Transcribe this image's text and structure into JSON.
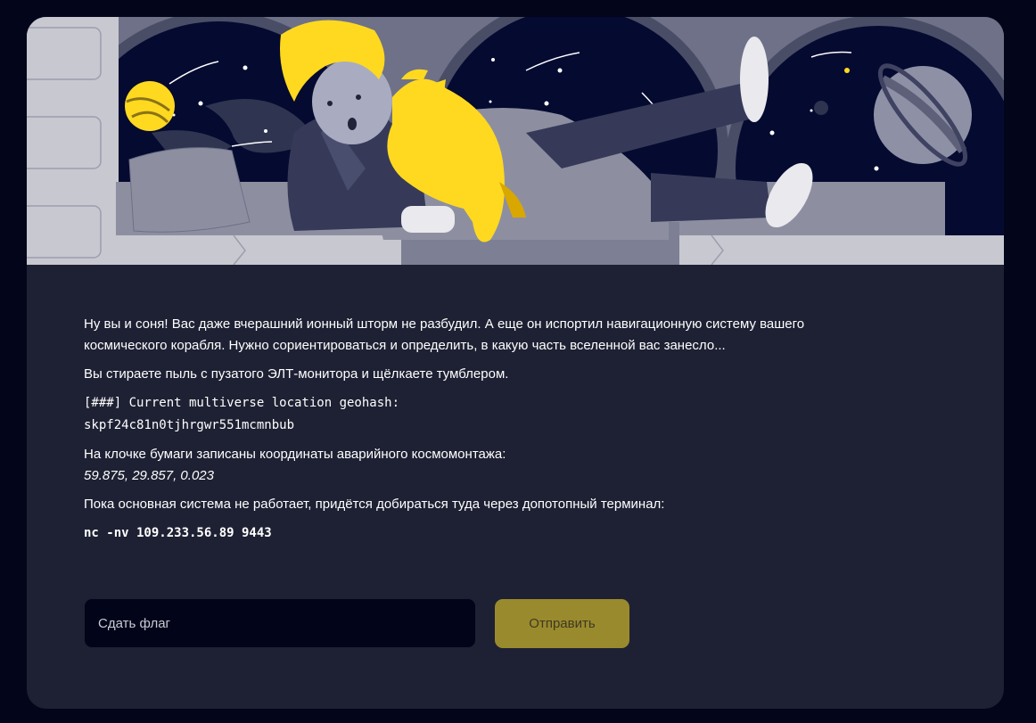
{
  "task": {
    "paragraph_1": "Ну вы и соня! Вас даже вчерашний ионный шторм не разбудил. А еще он испортил навигационную систему вашего космического корабля. Нужно сориентироваться и определить, в какую часть вселенной вас занесло...",
    "paragraph_2": "Вы стираете пыль с пузатого ЭЛТ-монитора и щёлкаете тумблером.",
    "terminal_line": "[###] Current multiverse location geohash:",
    "geohash": "skpf24c81n0tjhrgwr551mcmnbub",
    "paragraph_3": "На клочке бумаги записаны координаты аварийного космомонтажа:",
    "coordinates": "59.875, 29.857, 0.023",
    "paragraph_4": "Пока основная система не работает, придётся добираться туда через допотопный терминал:",
    "command": "nc -nv 109.233.56.89 9443"
  },
  "form": {
    "flag_placeholder": "Сдать флаг",
    "flag_value": "",
    "submit_label": "Отправить"
  },
  "colors": {
    "page_bg": "#03051a",
    "card_bg": "#1e2133",
    "input_bg": "#02041a",
    "button_bg": "#9a8a2e",
    "accent_yellow": "#ffd91f"
  }
}
